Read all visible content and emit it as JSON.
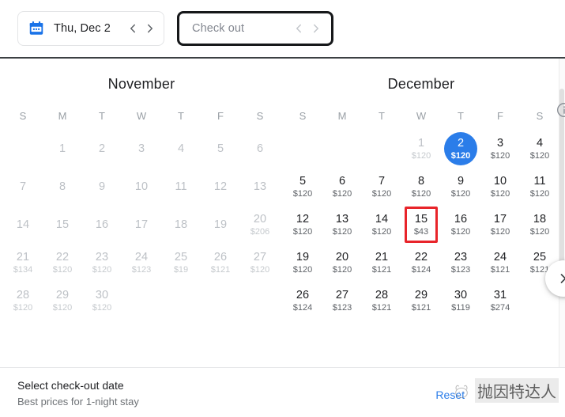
{
  "header": {
    "checkin": {
      "icon": "calendar-icon",
      "value": "Thu, Dec 2",
      "prev_icon": "chevron-left-icon",
      "next_icon": "chevron-right-icon"
    },
    "checkout": {
      "placeholder": "Check out",
      "value": "",
      "prev_icon": "chevron-left-icon",
      "next_icon": "chevron-right-icon"
    }
  },
  "colors": {
    "accent_blue": "#2b7de9",
    "annotation_red": "#e8242a",
    "text_primary": "#202124",
    "text_muted": "#5f6368",
    "text_disabled": "#bdc1c6"
  },
  "calendar": {
    "weekdays": [
      "S",
      "M",
      "T",
      "W",
      "T",
      "F",
      "S"
    ],
    "months": [
      {
        "name": "November",
        "lead_blanks": 1,
        "days": [
          {
            "day": "1",
            "price": "",
            "state": "disabled"
          },
          {
            "day": "2",
            "price": "",
            "state": "disabled"
          },
          {
            "day": "3",
            "price": "",
            "state": "disabled"
          },
          {
            "day": "4",
            "price": "",
            "state": "disabled"
          },
          {
            "day": "5",
            "price": "",
            "state": "disabled"
          },
          {
            "day": "6",
            "price": "",
            "state": "disabled"
          },
          {
            "day": "7",
            "price": "",
            "state": "disabled"
          },
          {
            "day": "8",
            "price": "",
            "state": "disabled"
          },
          {
            "day": "9",
            "price": "",
            "state": "disabled"
          },
          {
            "day": "10",
            "price": "",
            "state": "disabled"
          },
          {
            "day": "11",
            "price": "",
            "state": "disabled"
          },
          {
            "day": "12",
            "price": "",
            "state": "disabled"
          },
          {
            "day": "13",
            "price": "",
            "state": "disabled"
          },
          {
            "day": "14",
            "price": "",
            "state": "disabled"
          },
          {
            "day": "15",
            "price": "",
            "state": "disabled"
          },
          {
            "day": "16",
            "price": "",
            "state": "disabled"
          },
          {
            "day": "17",
            "price": "",
            "state": "disabled"
          },
          {
            "day": "18",
            "price": "",
            "state": "disabled"
          },
          {
            "day": "19",
            "price": "",
            "state": "disabled"
          },
          {
            "day": "20",
            "price": "$206",
            "state": "disabled"
          },
          {
            "day": "21",
            "price": "$134",
            "state": "disabled"
          },
          {
            "day": "22",
            "price": "$120",
            "state": "disabled"
          },
          {
            "day": "23",
            "price": "$120",
            "state": "disabled"
          },
          {
            "day": "24",
            "price": "$123",
            "state": "disabled"
          },
          {
            "day": "25",
            "price": "$19",
            "state": "disabled"
          },
          {
            "day": "26",
            "price": "$121",
            "state": "disabled"
          },
          {
            "day": "27",
            "price": "$120",
            "state": "disabled"
          },
          {
            "day": "28",
            "price": "$120",
            "state": "disabled"
          },
          {
            "day": "29",
            "price": "$120",
            "state": "disabled"
          },
          {
            "day": "30",
            "price": "$120",
            "state": "disabled"
          }
        ]
      },
      {
        "name": "December",
        "lead_blanks": 3,
        "days": [
          {
            "day": "1",
            "price": "$120",
            "state": "disabled"
          },
          {
            "day": "2",
            "price": "$120",
            "state": "selected"
          },
          {
            "day": "3",
            "price": "$120",
            "state": "normal"
          },
          {
            "day": "4",
            "price": "$120",
            "state": "normal"
          },
          {
            "day": "5",
            "price": "$120",
            "state": "normal"
          },
          {
            "day": "6",
            "price": "$120",
            "state": "normal"
          },
          {
            "day": "7",
            "price": "$120",
            "state": "normal"
          },
          {
            "day": "8",
            "price": "$120",
            "state": "normal"
          },
          {
            "day": "9",
            "price": "$120",
            "state": "normal"
          },
          {
            "day": "10",
            "price": "$120",
            "state": "normal"
          },
          {
            "day": "11",
            "price": "$120",
            "state": "normal"
          },
          {
            "day": "12",
            "price": "$120",
            "state": "normal"
          },
          {
            "day": "13",
            "price": "$120",
            "state": "normal"
          },
          {
            "day": "14",
            "price": "$120",
            "state": "normal"
          },
          {
            "day": "15",
            "price": "$43",
            "state": "normal",
            "annotated": true
          },
          {
            "day": "16",
            "price": "$120",
            "state": "normal"
          },
          {
            "day": "17",
            "price": "$120",
            "state": "normal"
          },
          {
            "day": "18",
            "price": "$120",
            "state": "normal"
          },
          {
            "day": "19",
            "price": "$120",
            "state": "normal"
          },
          {
            "day": "20",
            "price": "$120",
            "state": "normal"
          },
          {
            "day": "21",
            "price": "$121",
            "state": "normal"
          },
          {
            "day": "22",
            "price": "$124",
            "state": "normal"
          },
          {
            "day": "23",
            "price": "$123",
            "state": "normal"
          },
          {
            "day": "24",
            "price": "$121",
            "state": "normal"
          },
          {
            "day": "25",
            "price": "$121",
            "state": "normal"
          },
          {
            "day": "26",
            "price": "$124",
            "state": "normal"
          },
          {
            "day": "27",
            "price": "$123",
            "state": "normal"
          },
          {
            "day": "28",
            "price": "$121",
            "state": "normal"
          },
          {
            "day": "29",
            "price": "$121",
            "state": "normal"
          },
          {
            "day": "30",
            "price": "$119",
            "state": "normal"
          },
          {
            "day": "31",
            "price": "$274",
            "state": "normal"
          }
        ]
      }
    ],
    "next_month_icon": "chevron-right-icon",
    "info_icon": "info-icon"
  },
  "footer": {
    "title": "Select check-out date",
    "subtitle": "Best prices for 1-night stay",
    "reset_label": "Reset"
  },
  "watermark": {
    "text": "抛因特达人"
  }
}
